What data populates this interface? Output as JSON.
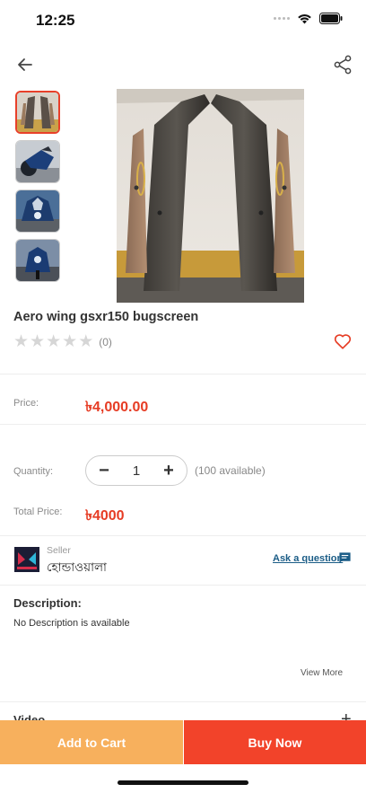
{
  "status_bar": {
    "time": "12:25"
  },
  "product": {
    "title": "Aero wing gsxr150 bugscreen",
    "rating_count": "(0)",
    "price_label": "Price:",
    "price": "৳4,000.00",
    "quantity_label": "Quantity:",
    "quantity": "1",
    "available": "(100 available)",
    "total_label": "Total Price:",
    "total": "৳4000"
  },
  "seller": {
    "label": "Seller",
    "name": "হোন্ডাওয়ালা",
    "ask_question": "Ask a question"
  },
  "description": {
    "title": "Description:",
    "text": "No Description is available",
    "view_more": "View More"
  },
  "video": {
    "title": "Video",
    "toggle": "+"
  },
  "actions": {
    "add_to_cart": "Add to Cart",
    "buy_now": "Buy Now"
  },
  "colors": {
    "accent": "#e63c24",
    "cart": "#f7b05d",
    "buy": "#f2432a",
    "link": "#1a5c86"
  }
}
